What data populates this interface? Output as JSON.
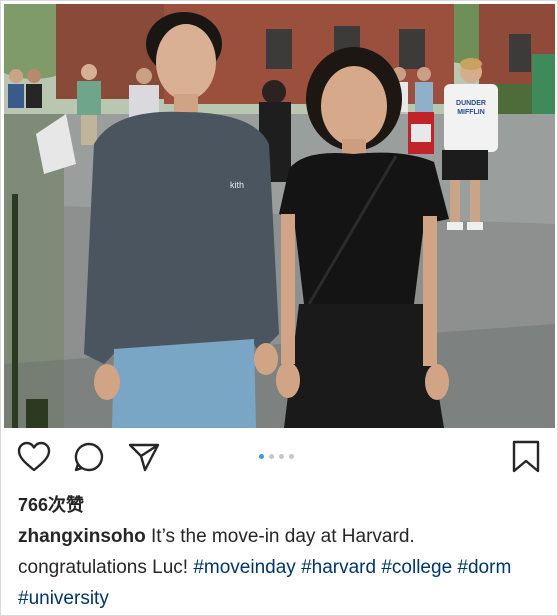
{
  "post": {
    "likes_text": "766次赞",
    "username": "zhangxinsoho",
    "caption_text": " It’s the move-in day at Harvard. congratulations Luc! ",
    "hashtags": [
      "#moveinday",
      "#harvard",
      "#college",
      "#dorm",
      "#university"
    ]
  },
  "carousel": {
    "total": 4,
    "active_index": 0
  },
  "photo": {
    "shirt_logo_text": "kith",
    "bystander_shirt_text_line1": "DUNDER",
    "bystander_shirt_text_line2": "MIFFLIN"
  },
  "icons": {
    "like": "heart-icon",
    "comment": "comment-bubble-icon",
    "share": "paper-plane-icon",
    "save": "bookmark-icon"
  },
  "colors": {
    "hashtag": "#003569",
    "carousel_active": "#3897f0",
    "carousel_inactive": "#c7c7c7",
    "text": "#262626"
  }
}
